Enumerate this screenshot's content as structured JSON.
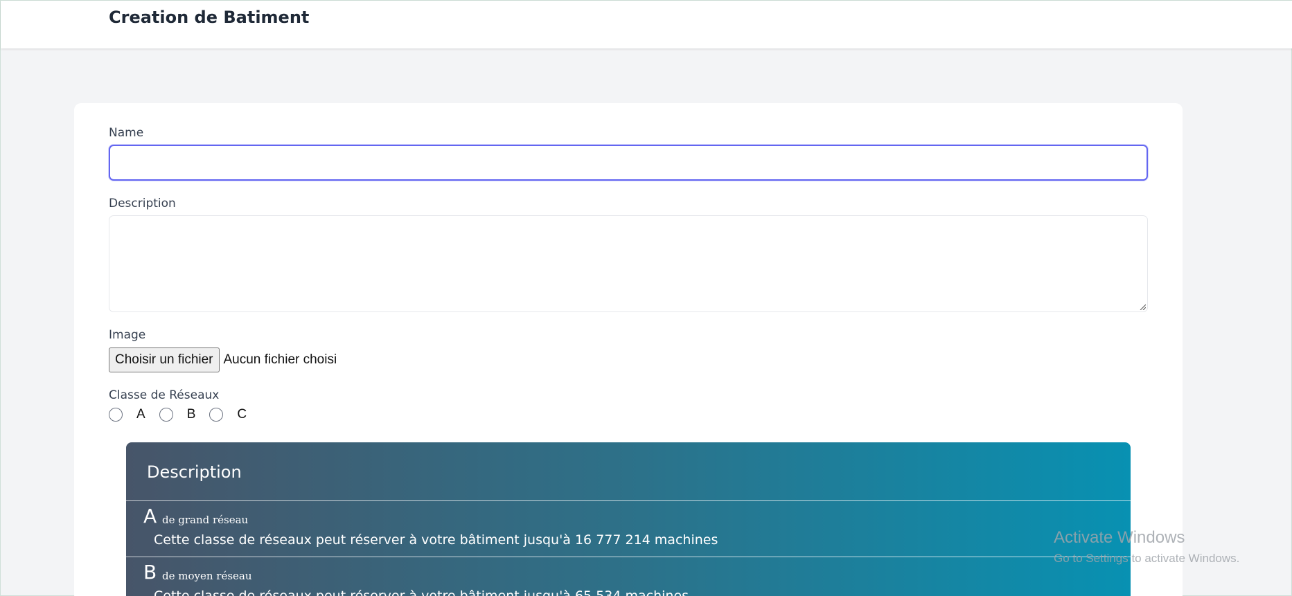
{
  "header": {
    "title": "Creation de Batiment"
  },
  "form": {
    "name_label": "Name",
    "name_value": "",
    "description_label": "Description",
    "description_value": "",
    "image_label": "Image",
    "file_button_label": "Choisir un fichier",
    "file_status": "Aucun fichier choisi",
    "network_class_label": "Classe de Réseaux",
    "options": [
      {
        "label": "A",
        "selected": false
      },
      {
        "label": "B",
        "selected": false
      },
      {
        "label": "C",
        "selected": false
      }
    ]
  },
  "description_panel": {
    "title": "Description",
    "gradient_colors": [
      "#475569",
      "#0891b2"
    ],
    "classes": [
      {
        "letter": "A",
        "subtitle": "de grand réseau",
        "text": "Cette classe de réseaux peut réserver à votre bâtiment jusqu'à 16 777 214 machines"
      },
      {
        "letter": "B",
        "subtitle": "de moyen réseau",
        "text": "Cette classe de réseaux peut réserver à votre bâtiment jusqu'à 65 534 machines"
      }
    ]
  },
  "watermark": {
    "title": "Activate Windows",
    "subtitle": "Go to Settings to activate Windows."
  },
  "colors": {
    "focus_border": "#6366f1",
    "page_background": "#f3f4f6"
  }
}
